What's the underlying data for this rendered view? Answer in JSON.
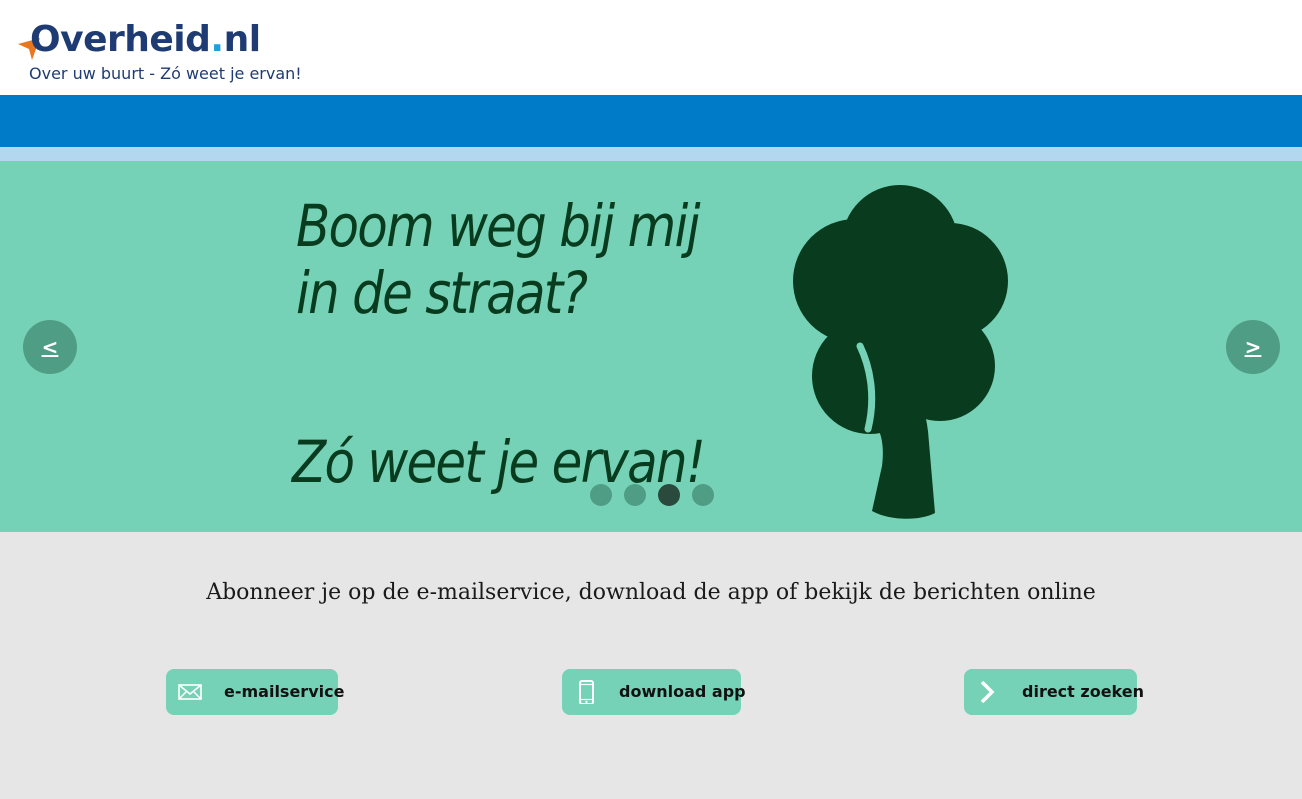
{
  "header": {
    "logo_main": "Overheid",
    "logo_dot": ".",
    "logo_tld": "nl",
    "tagline": "Over uw buurt - Zó weet je ervan!"
  },
  "hero": {
    "line1": "Boom weg bij mij",
    "line2": "in de straat?",
    "line3": "Zó weet je ervan!",
    "prev_label": "<",
    "next_label": ">",
    "slides_count": 4,
    "active_slide": 3,
    "illustration_icon": "tree-icon"
  },
  "subscribe": {
    "text": "Abonneer je op de e-mailservice, download de app of bekijk de berichten online"
  },
  "actions": [
    {
      "label": "e-mailservice",
      "icon": "envelope-icon"
    },
    {
      "label": "download app",
      "icon": "phone-icon"
    },
    {
      "label": "direct zoeken",
      "icon": "chevron-right-icon"
    }
  ],
  "colors": {
    "brand_blue": "#007bc7",
    "light_blue": "#b2d7ee",
    "hero_green": "#76d2b6",
    "tree_dark": "#093c1f",
    "logo_navy": "#1f3b73",
    "logo_orange": "#e8781e"
  }
}
